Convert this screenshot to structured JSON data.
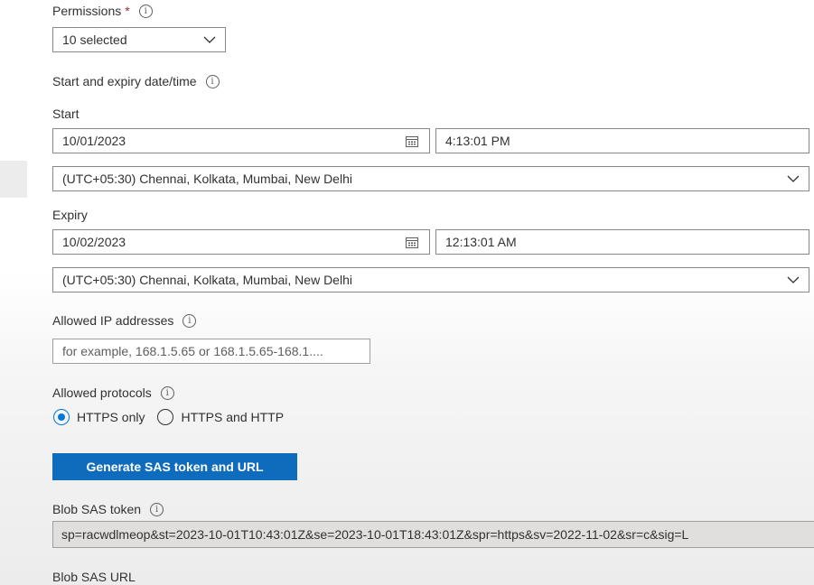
{
  "permissions": {
    "label": "Permissions",
    "required_mark": "*",
    "selected_value": "10 selected"
  },
  "date_section": {
    "label": "Start and expiry date/time"
  },
  "start": {
    "label": "Start",
    "date": "10/01/2023",
    "time": "4:13:01 PM",
    "timezone": "(UTC+05:30) Chennai, Kolkata, Mumbai, New Delhi"
  },
  "expiry": {
    "label": "Expiry",
    "date": "10/02/2023",
    "time": "12:13:01 AM",
    "timezone": "(UTC+05:30) Chennai, Kolkata, Mumbai, New Delhi"
  },
  "allowed_ip": {
    "label": "Allowed IP addresses",
    "placeholder": "for example, 168.1.5.65 or 168.1.5.65-168.1...."
  },
  "protocols": {
    "label": "Allowed protocols",
    "options": [
      {
        "label": "HTTPS only",
        "selected": true
      },
      {
        "label": "HTTPS and HTTP",
        "selected": false
      }
    ]
  },
  "generate_button": {
    "label": "Generate SAS token and URL"
  },
  "blob_sas_token": {
    "label": "Blob SAS token",
    "value": "sp=racwdlmeop&st=2023-10-01T10:43:01Z&se=2023-10-01T18:43:01Z&spr=https&sv=2022-11-02&sr=c&sig=L"
  },
  "blob_sas_url": {
    "label": "Blob SAS URL"
  },
  "info_glyph": "i",
  "icons": [
    "info-icon",
    "chevron-down-icon",
    "calendar-icon"
  ],
  "colors": {
    "accent": "#0078d4",
    "button": "#0f6cbd",
    "required": "#a4262c"
  }
}
